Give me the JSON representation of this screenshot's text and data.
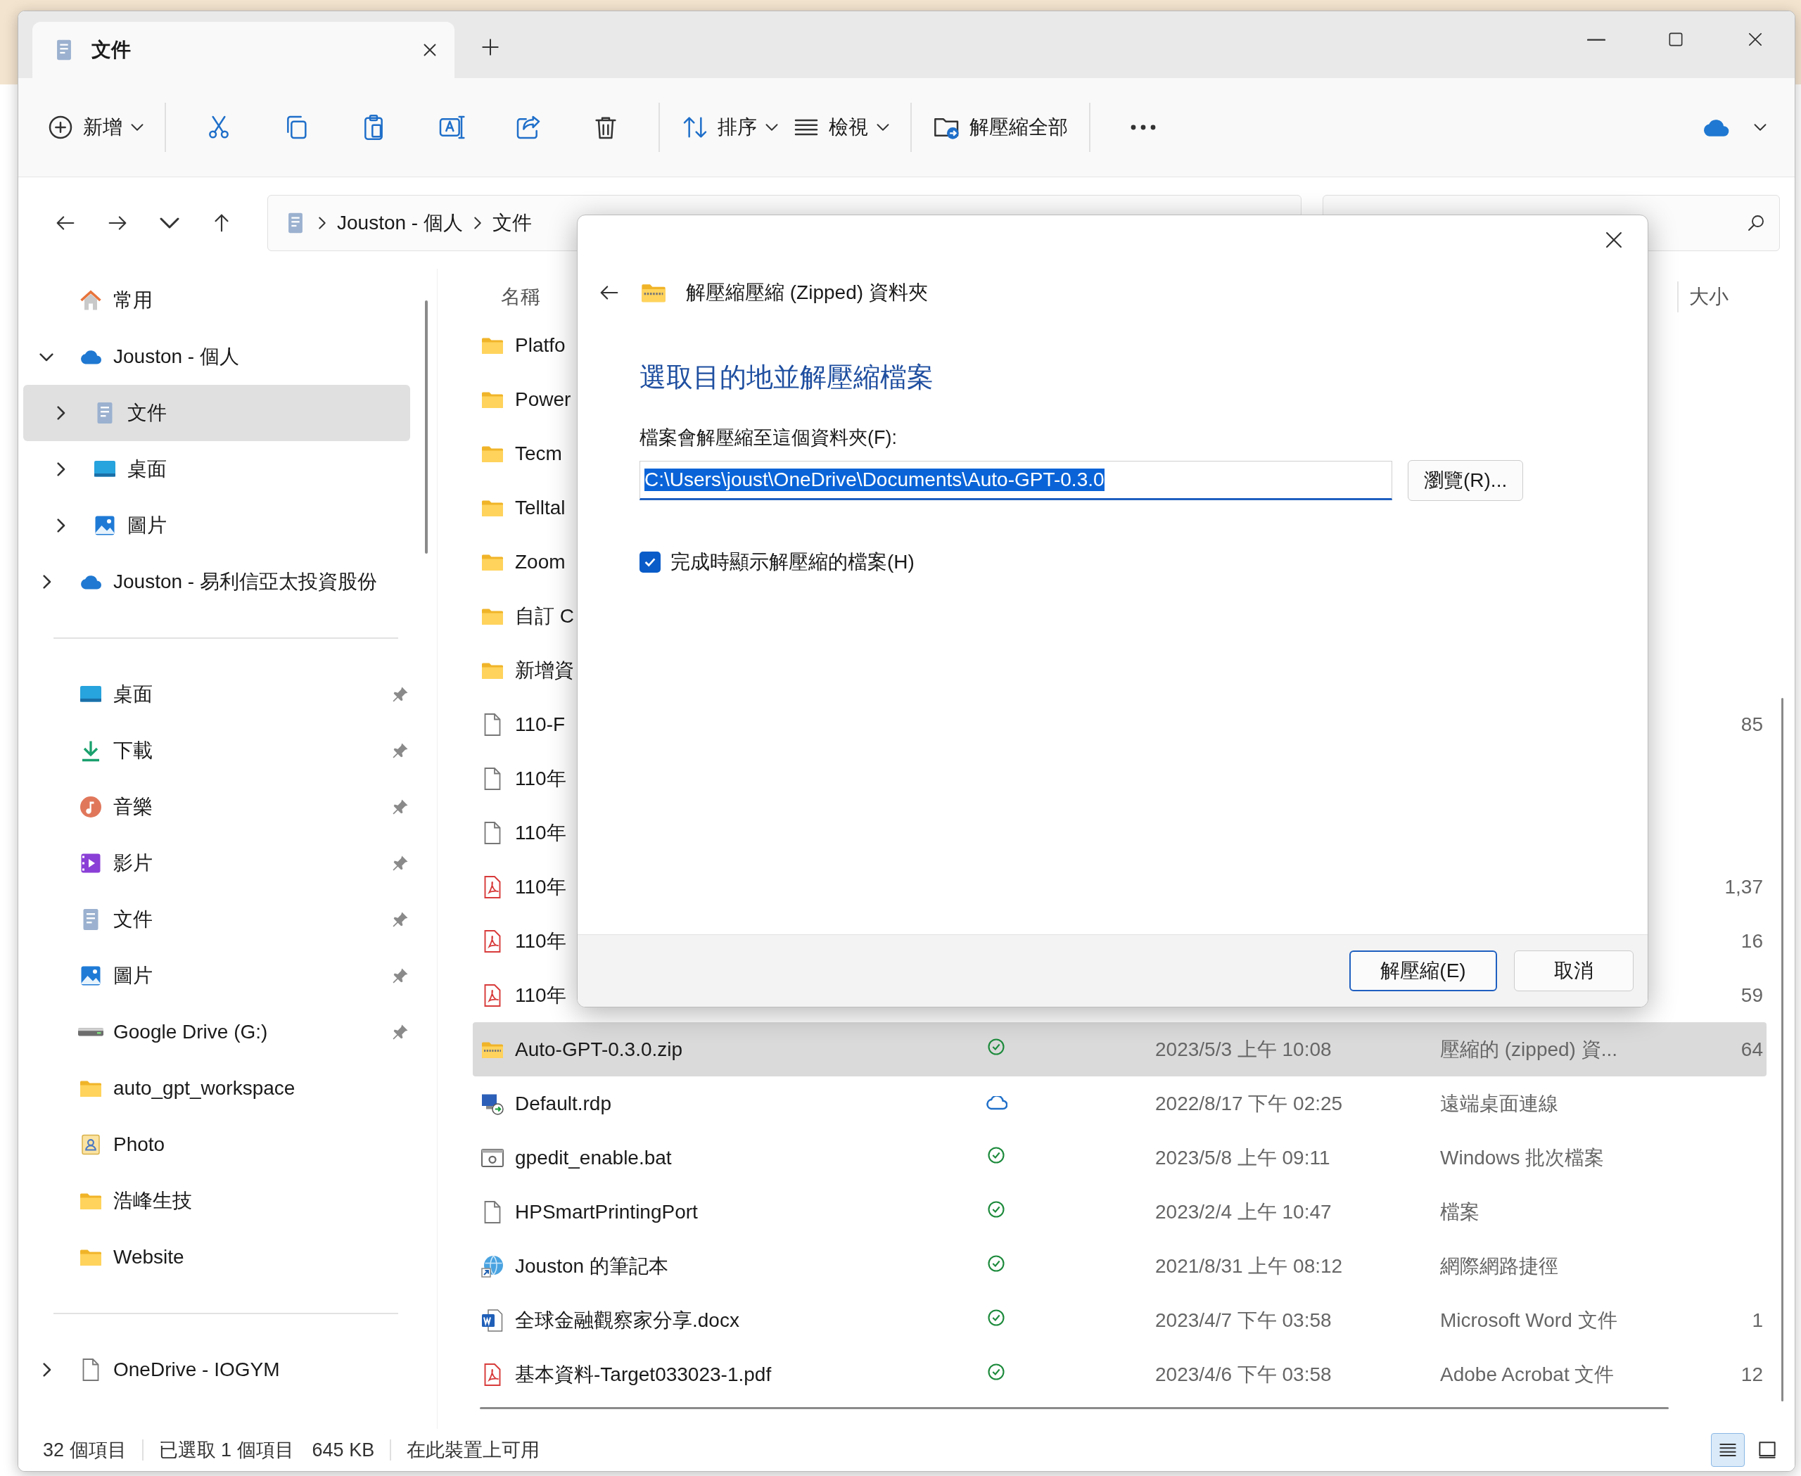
{
  "window": {
    "tab": {
      "title": "文件"
    }
  },
  "toolbar": {
    "groups": [
      [
        {
          "kind": "new",
          "label": "新增",
          "dropdown": true
        }
      ],
      [
        {
          "kind": "cut",
          "dropdown": false
        },
        {
          "kind": "copy",
          "dropdown": false
        },
        {
          "kind": "paste",
          "dropdown": false
        },
        {
          "kind": "rename",
          "dropdown": false
        },
        {
          "kind": "share",
          "dropdown": false
        },
        {
          "kind": "delete",
          "dropdown": false
        }
      ],
      [
        {
          "kind": "sort",
          "label": "排序",
          "dropdown": true
        },
        {
          "kind": "view",
          "label": "檢視",
          "dropdown": true
        }
      ],
      [
        {
          "kind": "extract",
          "label": "解壓縮全部",
          "dropdown": false
        }
      ],
      [
        {
          "kind": "more",
          "dropdown": false
        }
      ]
    ]
  },
  "address_bar": {
    "breadcrumb": [
      "Jouston - 個人",
      "文件"
    ]
  },
  "sidebar": {
    "sections": [
      {
        "items": [
          {
            "label": "常用",
            "kind": "home",
            "selected": false
          },
          {
            "label": "Jouston - 個人",
            "kind": "cloud",
            "selected": false,
            "expanded": true,
            "children": [
              {
                "label": "文件",
                "kind": "docs",
                "selected": true,
                "expanded": false
              },
              {
                "label": "桌面",
                "kind": "desktop",
                "selected": false,
                "expanded": false
              },
              {
                "label": "圖片",
                "kind": "pictures",
                "selected": false,
                "expanded": false
              }
            ]
          },
          {
            "label": "Jouston - 易利信亞太投資股份",
            "kind": "cloud",
            "selected": false,
            "expanded": false
          }
        ]
      },
      {
        "items": [
          {
            "label": "桌面",
            "kind": "desktop",
            "selected": false,
            "pinned": true
          },
          {
            "label": "下載",
            "kind": "download",
            "selected": false,
            "pinned": true
          },
          {
            "label": "音樂",
            "kind": "music",
            "selected": false,
            "pinned": true
          },
          {
            "label": "影片",
            "kind": "video",
            "selected": false,
            "pinned": true
          },
          {
            "label": "文件",
            "kind": "docs",
            "selected": false,
            "pinned": true
          },
          {
            "label": "圖片",
            "kind": "pictures",
            "selected": false,
            "pinned": true
          },
          {
            "label": "Google Drive (G:)",
            "kind": "drive",
            "selected": false,
            "pinned": true
          },
          {
            "label": "auto_gpt_workspace",
            "kind": "folder",
            "selected": false,
            "pinned": false
          },
          {
            "label": "Photo",
            "kind": "contact",
            "selected": false,
            "pinned": false
          },
          {
            "label": "浩峰生技",
            "kind": "folder",
            "selected": false,
            "pinned": false
          },
          {
            "label": "Website",
            "kind": "folder",
            "selected": false,
            "pinned": false
          }
        ]
      },
      {
        "items": [
          {
            "label": "OneDrive - IOGYM",
            "kind": "file",
            "selected": false,
            "expanded": false
          }
        ]
      }
    ]
  },
  "file_list": {
    "columns": [
      "名稱",
      "大小"
    ],
    "rows": [
      {
        "name": "Platfo",
        "kind": "folder",
        "selected": false
      },
      {
        "name": "Power",
        "kind": "folder",
        "selected": false
      },
      {
        "name": "Tecm",
        "kind": "folder",
        "selected": false
      },
      {
        "name": "Telltal",
        "kind": "folder",
        "selected": false
      },
      {
        "name": "Zoom",
        "kind": "folder",
        "selected": false
      },
      {
        "name": "自訂 C",
        "kind": "folder",
        "selected": false
      },
      {
        "name": "新增資",
        "kind": "folder",
        "selected": false
      },
      {
        "name": "110-F",
        "kind": "file",
        "size": "85",
        "selected": false
      },
      {
        "name": "110年",
        "kind": "file",
        "selected": false
      },
      {
        "name": "110年",
        "kind": "file",
        "selected": false
      },
      {
        "name": "110年",
        "kind": "pdf",
        "size": "1,37",
        "selected": false
      },
      {
        "name": "110年",
        "kind": "pdf",
        "size": "16",
        "selected": false
      },
      {
        "name": "110年",
        "kind": "pdf",
        "size": "59",
        "selected": false
      },
      {
        "name": "Auto-GPT-0.3.0.zip",
        "kind": "zip",
        "synced": true,
        "date": "2023/5/3 上午 10:08",
        "type": "壓縮的 (zipped) 資...",
        "size": "64",
        "selected": true
      },
      {
        "name": "Default.rdp",
        "kind": "rdp",
        "synced": false,
        "date": "2022/8/17 下午 02:25",
        "type": "遠端桌面連線",
        "selected": false
      },
      {
        "name": "gpedit_enable.bat",
        "kind": "bat",
        "synced": true,
        "date": "2023/5/8 上午 09:11",
        "type": "Windows 批次檔案",
        "selected": false
      },
      {
        "name": "HPSmartPrintingPort",
        "kind": "file",
        "synced": true,
        "date": "2023/2/4 上午 10:47",
        "type": "檔案",
        "selected": false
      },
      {
        "name": "Jouston 的筆記本",
        "kind": "url",
        "synced": true,
        "date": "2021/8/31 上午 08:12",
        "type": "網際網路捷徑",
        "selected": false
      },
      {
        "name": "全球金融觀察家分享.docx",
        "kind": "docx",
        "synced": true,
        "date": "2023/4/7 下午 03:58",
        "type": "Microsoft Word 文件",
        "size": "1",
        "selected": false
      },
      {
        "name": "基本資料-Target033023-1.pdf",
        "kind": "pdf",
        "synced": true,
        "date": "2023/4/6 下午 03:58",
        "type": "Adobe Acrobat 文件",
        "size": "12",
        "selected": false
      }
    ]
  },
  "dialog": {
    "title": "解壓縮壓縮 (Zipped) 資料夾",
    "heading": "選取目的地並解壓縮檔案",
    "destination_label": "檔案會解壓縮至這個資料夾(F):",
    "destination": "C:\\Users\\joust\\OneDrive\\Documents\\Auto-GPT-0.3.0",
    "browse_button": "瀏覽(R)...",
    "show_files_checkbox": {
      "label": "完成時顯示解壓縮的檔案(H)",
      "checked": true
    },
    "buttons": [
      {
        "label": "解壓縮(E)",
        "default": true
      },
      {
        "label": "取消",
        "default": false
      }
    ]
  },
  "status_bar": {
    "item_count": "32 個項目",
    "selection": "已選取 1 個項目",
    "selection_size": "645 KB",
    "availability": "在此裝置上可用",
    "view_modes": [
      {
        "kind": "details",
        "selected": true
      },
      {
        "kind": "tiles",
        "selected": false
      }
    ]
  }
}
